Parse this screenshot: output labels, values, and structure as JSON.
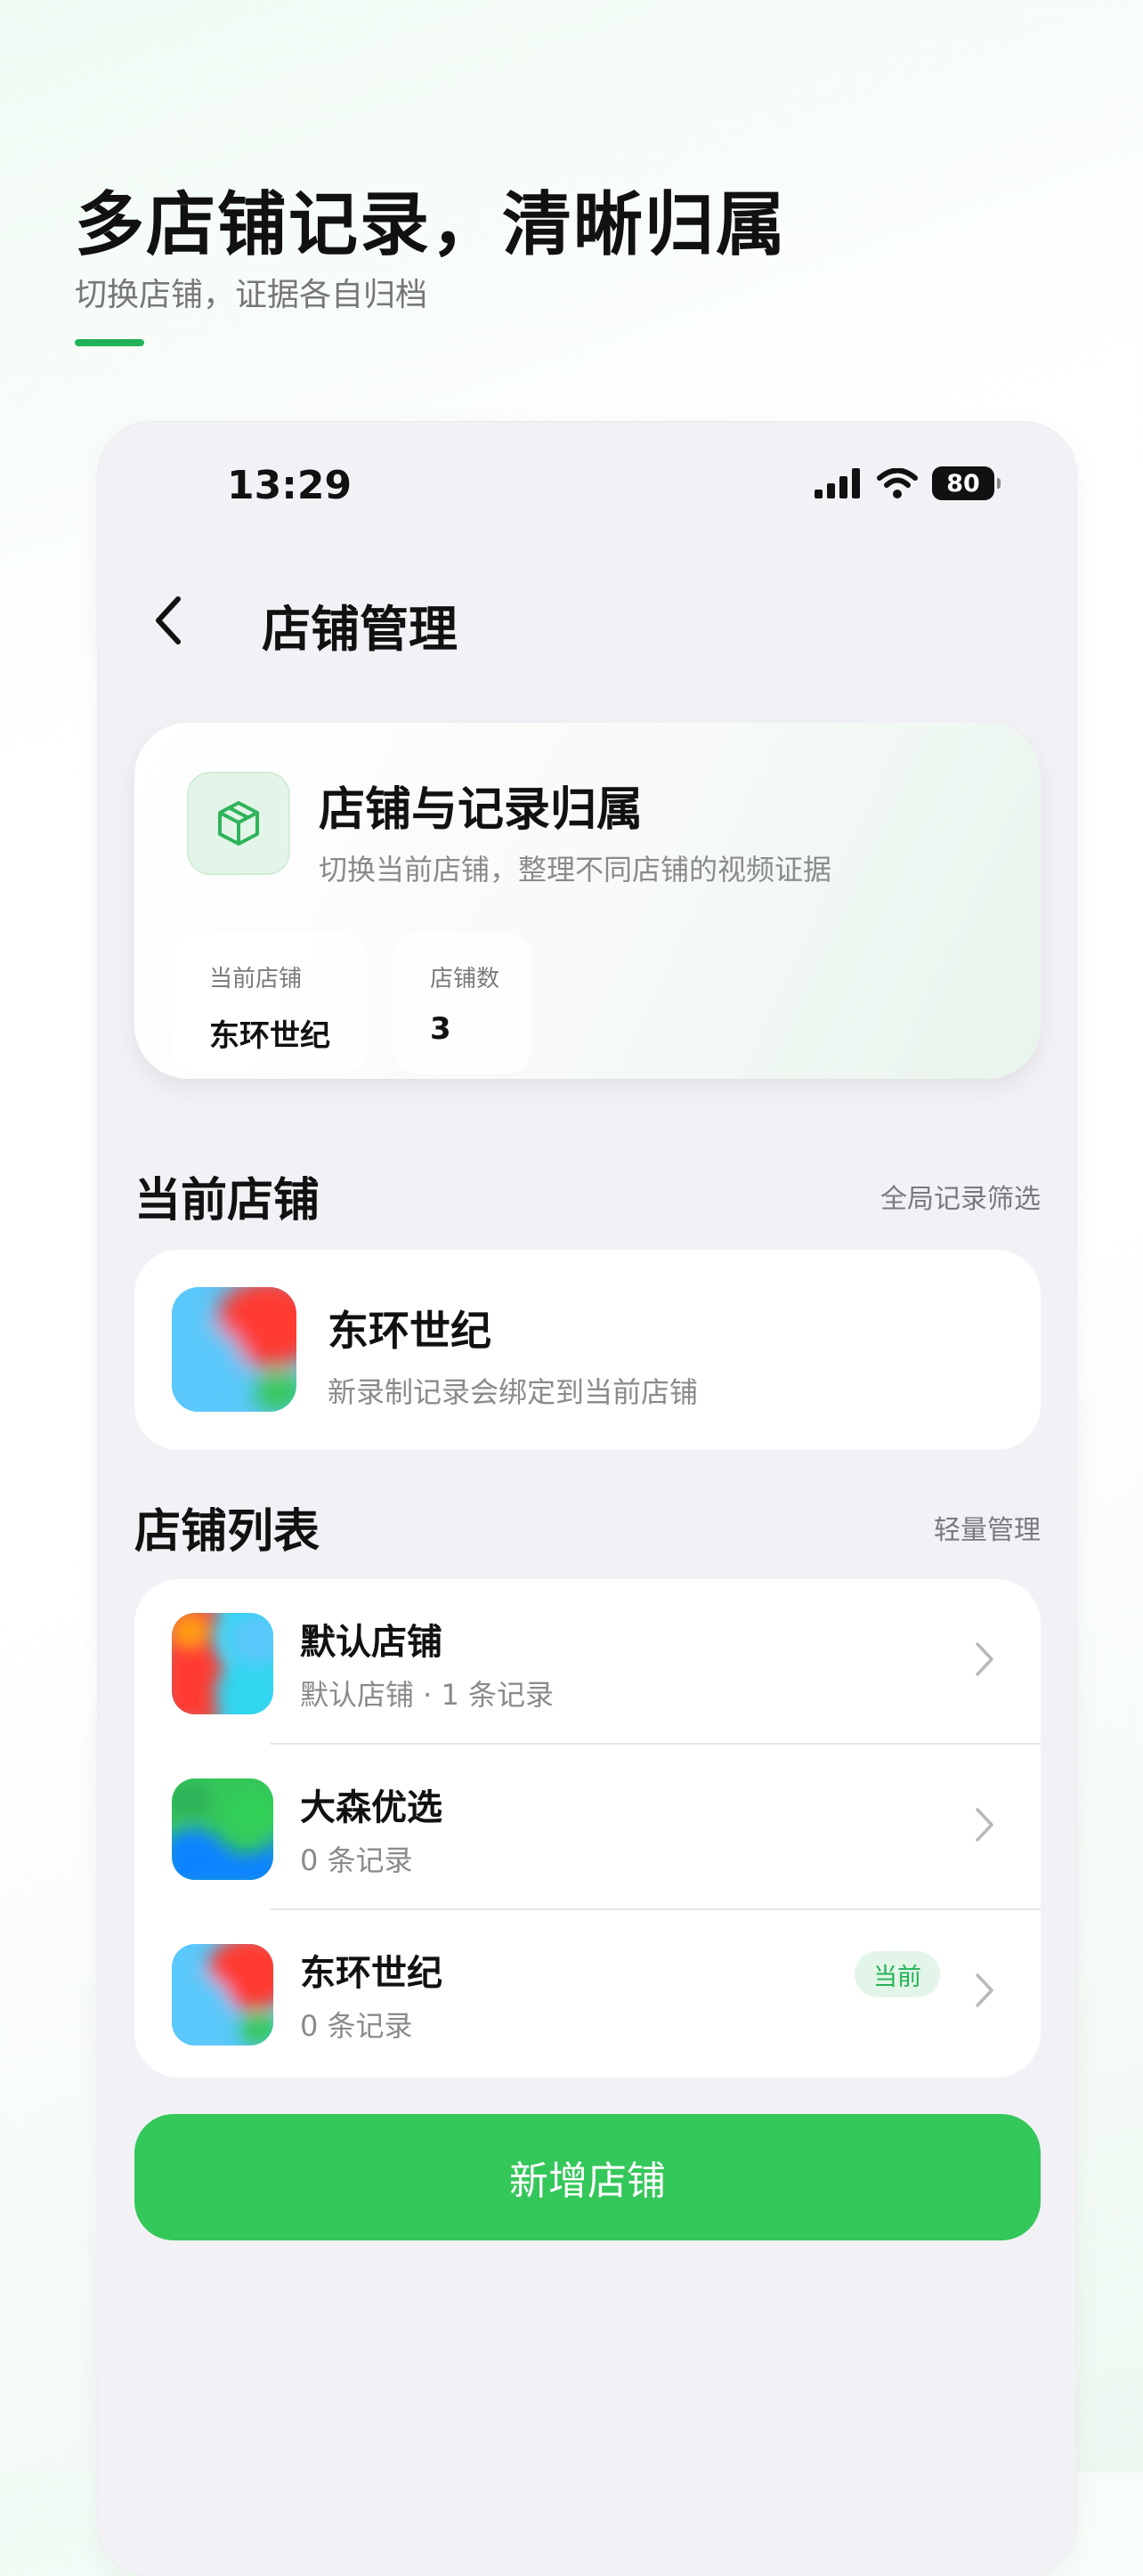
{
  "promo": {
    "title": "多店铺记录，清晰归属",
    "subtitle": "切换店铺，证据各自归档",
    "accent_color": "#22b356"
  },
  "status_bar": {
    "time": "13:29",
    "battery": "80",
    "icons": [
      "signal-icon",
      "wifi-icon",
      "battery-icon"
    ]
  },
  "nav": {
    "back_icon": "chevron-left-icon",
    "title": "店铺管理"
  },
  "hero": {
    "icon": "cube-icon",
    "title": "店铺与记录归属",
    "subtitle": "切换当前店铺，整理不同店铺的视频证据",
    "stats": [
      {
        "label": "当前店铺",
        "value": "东环世纪"
      },
      {
        "label": "店铺数",
        "value": "3"
      }
    ]
  },
  "current_section": {
    "title": "当前店铺",
    "link": "全局记录筛选",
    "store": {
      "name": "东环世纪",
      "description": "新录制记录会绑定到当前店铺"
    }
  },
  "list_section": {
    "title": "店铺列表",
    "link": "轻量管理",
    "stores": [
      {
        "name": "默认店铺",
        "subtitle": "默认店铺 · 1 条记录",
        "badge": ""
      },
      {
        "name": "大森优选",
        "subtitle": "0 条记录",
        "badge": ""
      },
      {
        "name": "东环世纪",
        "subtitle": "0 条记录",
        "badge": "当前"
      }
    ]
  },
  "add_button": {
    "label": "新增店铺",
    "color": "#34c759"
  }
}
